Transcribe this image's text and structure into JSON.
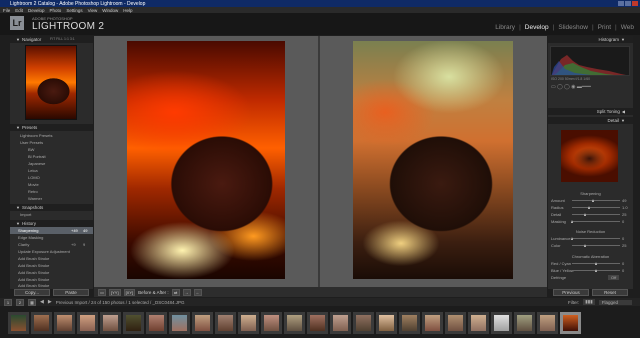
{
  "window": {
    "title": "Lightroom 2 Catalog - Adobe Photoshop Lightroom - Develop"
  },
  "menu": [
    "File",
    "Edit",
    "Develop",
    "Photo",
    "Settings",
    "View",
    "Window",
    "Help"
  ],
  "identity": {
    "sub": "ADOBE PHOTOSHOP",
    "name": "LIGHTROOM 2",
    "logo": "Lr"
  },
  "modules": [
    {
      "label": "Library",
      "active": false
    },
    {
      "label": "Develop",
      "active": true
    },
    {
      "label": "Slideshow",
      "active": false
    },
    {
      "label": "Print",
      "active": false
    },
    {
      "label": "Web",
      "active": false
    }
  ],
  "left": {
    "navigator": {
      "title": "Navigator",
      "zoom": [
        "FIT",
        "FILL",
        "1:1",
        "3:1"
      ]
    },
    "presets": {
      "title": "Presets",
      "groups": [
        "Lightroom Presets",
        "User Presets"
      ],
      "items": [
        "BW",
        "Bl Portrait",
        "Japanese",
        "Leica",
        "LOMO",
        "Movie",
        "Retro",
        "Warmer"
      ]
    },
    "snapshots": {
      "title": "Snapshots",
      "items": [
        "Import"
      ]
    },
    "history": {
      "title": "History",
      "items": [
        {
          "label": "Sharpening",
          "value": "+49",
          "value2": "49",
          "selected": true
        },
        {
          "label": "Edge Masking"
        },
        {
          "label": "Clarity",
          "value": "+9",
          "value2": "9"
        },
        {
          "label": "Update Exposure Adjustment"
        },
        {
          "label": "Add Brush Stroke"
        },
        {
          "label": "Add Brush Stroke"
        },
        {
          "label": "Add Brush Stroke"
        },
        {
          "label": "Add Brush Stroke"
        },
        {
          "label": "Add Brush Stroke"
        }
      ]
    },
    "copy_btn": "Copy...",
    "paste_btn": "Paste"
  },
  "right": {
    "histogram": {
      "title": "Histogram",
      "info": "ISO 200  50mm  f/1.8  1/60"
    },
    "split_toning": {
      "title": "Split Toning"
    },
    "detail": {
      "title": "Detail"
    },
    "sharpening": {
      "title": "Sharpening",
      "rows": [
        {
          "label": "Amount",
          "value": "49"
        },
        {
          "label": "Radius",
          "value": "1.0"
        },
        {
          "label": "Detail",
          "value": "25"
        },
        {
          "label": "Masking",
          "value": "0"
        }
      ]
    },
    "noise": {
      "title": "Noise Reduction",
      "rows": [
        {
          "label": "Luminance",
          "value": "0"
        },
        {
          "label": "Color",
          "value": "25"
        }
      ]
    },
    "chromatic": {
      "title": "Chromatic Aberration",
      "rows": [
        {
          "label": "Red / Cyan",
          "value": "0"
        },
        {
          "label": "Blue / Yellow",
          "value": "0"
        },
        {
          "label": "Defringe",
          "value": "Off"
        }
      ]
    },
    "previous_btn": "Previous",
    "reset_btn": "Reset"
  },
  "toolbar": {
    "view1": "[YY]",
    "view2": "[XY]",
    "before_after": "Before & After :"
  },
  "filmstrip": {
    "nav": "Previous Import / 24 of 150 photos / 1 selected / _DSC0484.JPG",
    "filter_label": "Filter:",
    "filter_value": "Flagged",
    "page1": "1",
    "page2": "2"
  },
  "colors": {
    "titlebar": "#0f2a66",
    "active_module": "#eeeeee",
    "selected_row": "#5a6068"
  }
}
